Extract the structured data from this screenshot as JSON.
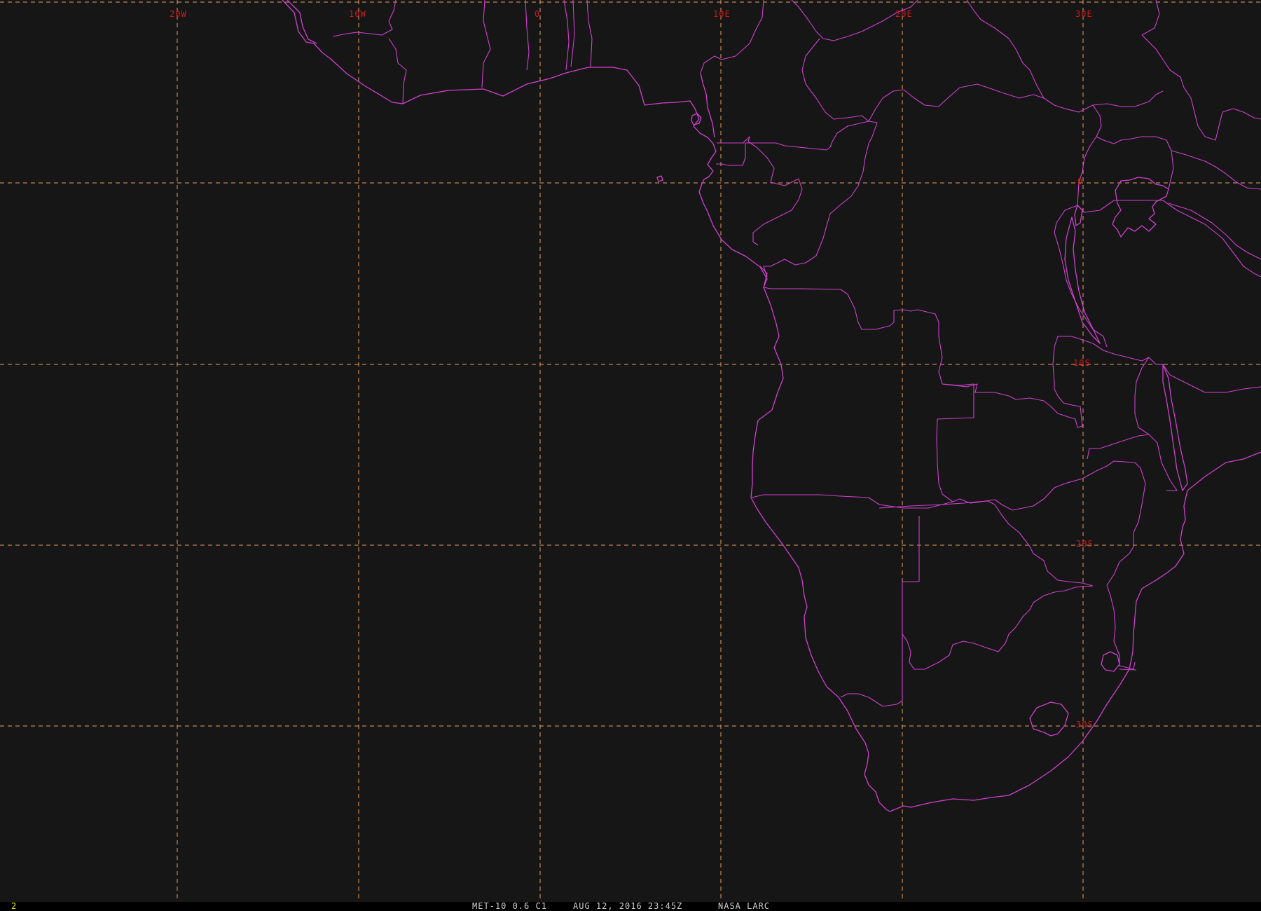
{
  "colors": {
    "background": "#161616",
    "coastline": "#d040d0",
    "graticule": "#e8a060",
    "grid_label": "#c81c1c",
    "frame_number": "#e8e800",
    "status_text": "#cfcfcf"
  },
  "map": {
    "projection": "geostationary satellite view",
    "region": "Southern and Central Africa with South Atlantic",
    "layers": [
      "coastlines",
      "country-borders",
      "lat-lon-graticule"
    ],
    "longitude_labels": [
      {
        "text": "20W",
        "lon": -20
      },
      {
        "text": "10W",
        "lon": -10
      },
      {
        "text": "0",
        "lon": 0
      },
      {
        "text": "10E",
        "lon": 10
      },
      {
        "text": "20E",
        "lon": 20
      },
      {
        "text": "30E",
        "lon": 30
      }
    ],
    "latitude_labels": [
      {
        "text": "0",
        "lat": 0
      },
      {
        "text": "10S",
        "lat": -10
      },
      {
        "text": "20S",
        "lat": -20
      },
      {
        "text": "30S",
        "lat": -30
      }
    ]
  },
  "status_bar": {
    "frame_number": "2",
    "satellite_info": "MET-10 0.6 C1",
    "timestamp": "AUG 12, 2016 23:45Z",
    "credit": "NASA LARC"
  }
}
